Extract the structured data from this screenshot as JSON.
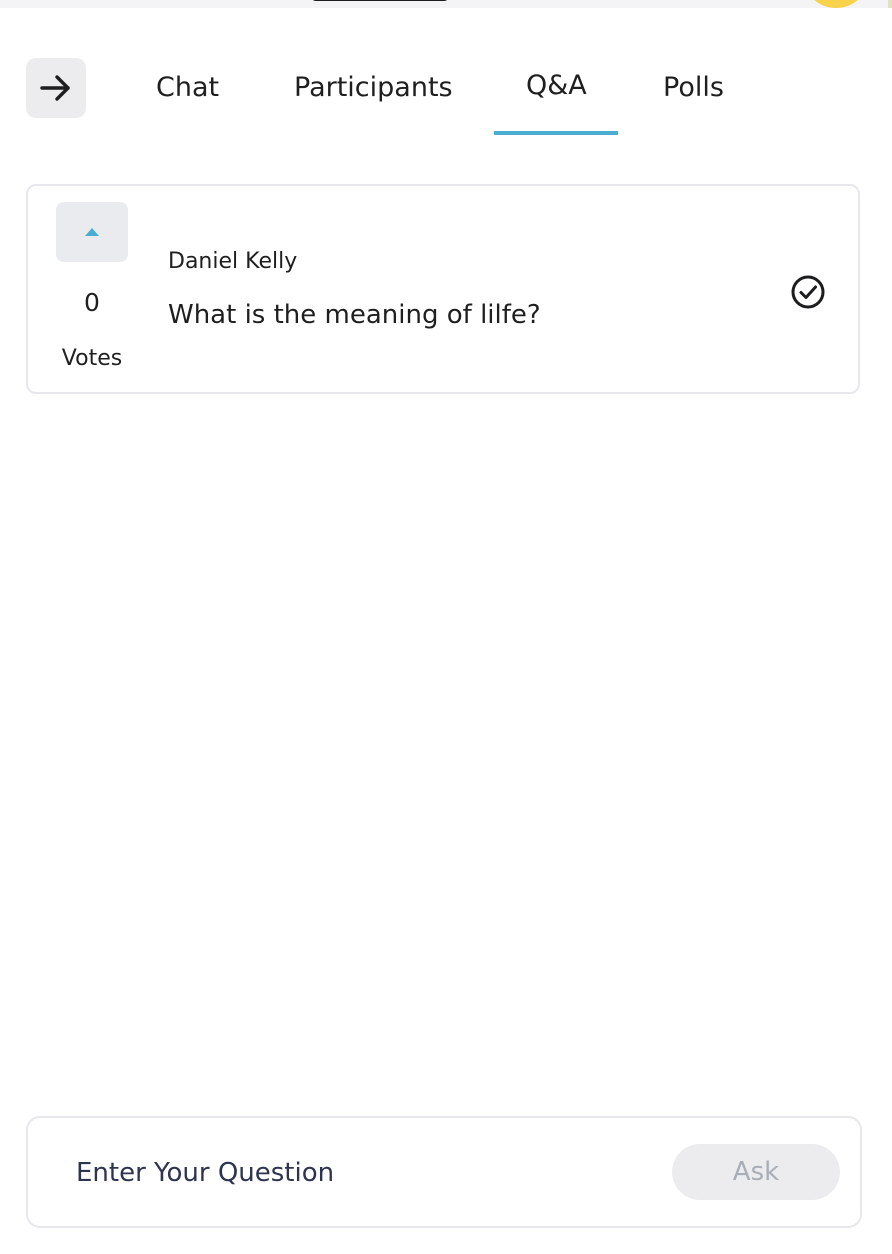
{
  "header": {
    "collapse_icon": "arrow-right-icon",
    "tabs": [
      {
        "label": "Chat",
        "active": false
      },
      {
        "label": "Participants",
        "active": false
      },
      {
        "label": "Q&A",
        "active": true
      },
      {
        "label": "Polls",
        "active": false
      }
    ],
    "active_color": "#4aaed3"
  },
  "questions": [
    {
      "votes": "0",
      "votes_label": "Votes",
      "author": "Daniel Kelly",
      "text": "What is the meaning of lilfe?",
      "upvote_icon": "caret-up-icon",
      "status_icon": "check-circle-icon"
    }
  ],
  "ask": {
    "placeholder": "Enter Your Question",
    "button_label": "Ask"
  }
}
